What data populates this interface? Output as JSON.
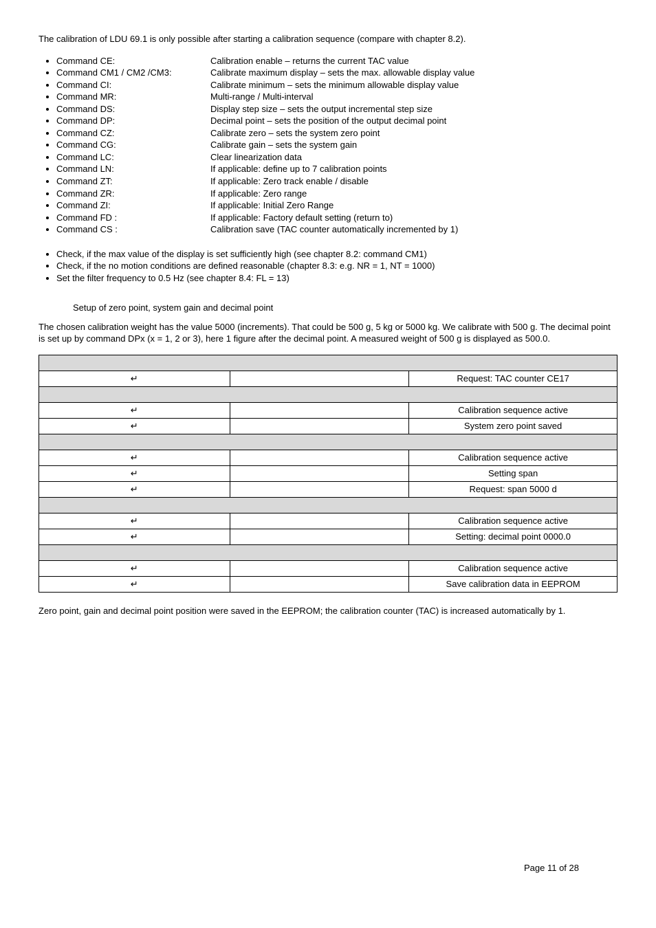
{
  "intro": "The calibration of LDU 69.1 is only possible after starting a calibration sequence (compare with chapter 8.2).",
  "commands": [
    {
      "name": "Command CE:",
      "desc": "Calibration enable – returns the current TAC value"
    },
    {
      "name": "Command CM1 / CM2 /CM3:",
      "desc": "Calibrate maximum display – sets the max. allowable display value"
    },
    {
      "name": "Command CI:",
      "desc": "Calibrate minimum – sets the minimum allowable display value"
    },
    {
      "name": "Command MR:",
      "desc": "Multi-range / Multi-interval"
    },
    {
      "name": "Command DS:",
      "desc": "Display step size – sets the output incremental step size"
    },
    {
      "name": "Command DP:",
      "desc": "Decimal point – sets the position of the output decimal point"
    },
    {
      "name": "Command CZ:",
      "desc": "Calibrate zero – sets the system zero point"
    },
    {
      "name": "Command CG:",
      "desc": "Calibrate gain – sets the system gain"
    },
    {
      "name": "Command LC:",
      "desc": "Clear linearization data"
    },
    {
      "name": "Command LN:",
      "desc": "If applicable: define up to 7 calibration points"
    },
    {
      "name": "Command ZT:",
      "desc": "If applicable: Zero track enable / disable"
    },
    {
      "name": "Command ZR:",
      "desc": "If applicable: Zero range"
    },
    {
      "name": "Command ZI:",
      "desc": "If applicable: Initial Zero Range"
    },
    {
      "name": "Command FD :",
      "desc": "If applicable: Factory default setting (return to)"
    },
    {
      "name": "Command CS :",
      "desc": "Calibration save (TAC counter automatically incremented by 1)"
    }
  ],
  "checks": [
    "Check, if the max value of the display is set sufficiently high (see chapter 8.2: command CM1)",
    "Check, if the no motion conditions are defined reasonable (chapter 8.3: e.g. NR = 1, NT = 1000)",
    "Set the filter frequency to 0.5 Hz (see chapter 8.4: FL = 13)"
  ],
  "sub_heading": "Setup of zero point, system gain and decimal point",
  "para": "The chosen calibration weight has the value 5000 (increments). That could be 500 g, 5 kg or 5000 kg. We calibrate with 500 g. The decimal point is set up by command DPx (x = 1, 2 or 3), here 1 figure after the decimal point. A measured weight of 500 g is displayed as 500.0.",
  "rows": [
    {
      "c1": "",
      "c2": "",
      "c3": "",
      "gray": true
    },
    {
      "c1": "↵",
      "c2": "",
      "c3": "Request: TAC counter CE17",
      "gray": false
    },
    {
      "c1": "",
      "c2": "",
      "c3": "",
      "gray": true
    },
    {
      "c1": "↵",
      "c2": "",
      "c3": "Calibration sequence active",
      "gray": false
    },
    {
      "c1": "↵",
      "c2": "",
      "c3": "System zero point saved",
      "gray": false
    },
    {
      "c1": "",
      "c2": "",
      "c3": "",
      "gray": true
    },
    {
      "c1": "↵",
      "c2": "",
      "c3": "Calibration sequence active",
      "gray": false
    },
    {
      "c1": "↵",
      "c2": "",
      "c3": "Setting span",
      "gray": false
    },
    {
      "c1": "↵",
      "c2": "",
      "c3": "Request: span 5000 d",
      "gray": false
    },
    {
      "c1": "",
      "c2": "",
      "c3": "",
      "gray": true
    },
    {
      "c1": "↵",
      "c2": "",
      "c3": "Calibration sequence active",
      "gray": false
    },
    {
      "c1": "↵",
      "c2": "",
      "c3": "Setting: decimal point 0000.0",
      "gray": false
    },
    {
      "c1": "",
      "c2": "",
      "c3": "",
      "gray": true
    },
    {
      "c1": "↵",
      "c2": "",
      "c3": "Calibration sequence active",
      "gray": false
    },
    {
      "c1": "↵",
      "c2": "",
      "c3": "Save calibration data in EEPROM",
      "gray": false
    }
  ],
  "closing": "Zero point, gain and decimal point position were saved in the EEPROM;  the calibration counter (TAC) is increased automatically by 1.",
  "footer": "Page 11 of 28"
}
